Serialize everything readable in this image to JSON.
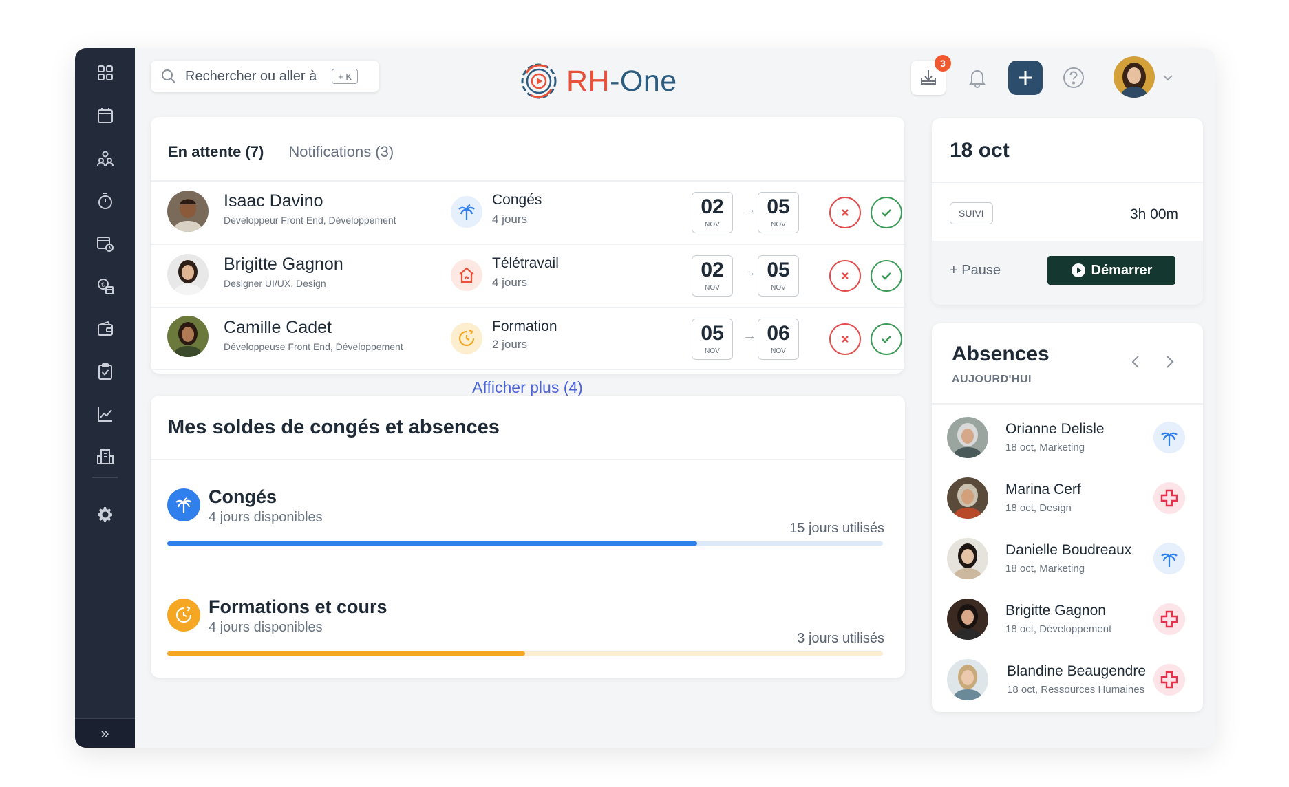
{
  "app": {
    "logo_rh": "RH",
    "logo_one": "-One"
  },
  "sidebar": {
    "items": [
      "dashboard",
      "calendar",
      "team",
      "timer",
      "schedule",
      "finance",
      "wallet",
      "tasks",
      "analytics",
      "organization",
      "settings"
    ],
    "collapse_label": "»"
  },
  "search": {
    "label": "Rechercher ou aller à",
    "shortcut": "+ K"
  },
  "topbar": {
    "inbox_count": "3"
  },
  "requests": {
    "tabs": [
      "En attente (7)",
      "Notifications (3)"
    ],
    "rows": [
      {
        "name": "Isaac Davino",
        "role": "Développeur Front End, Développement",
        "type": "Congés",
        "days": "4 jours",
        "from_day": "02",
        "from_month": "NOV",
        "to_day": "05",
        "to_month": "NOV"
      },
      {
        "name": "Brigitte Gagnon",
        "role": "Designer UI/UX, Design",
        "type": "Télétravail",
        "days": "4 jours",
        "from_day": "02",
        "from_month": "NOV",
        "to_day": "05",
        "to_month": "NOV"
      },
      {
        "name": "Camille Cadet",
        "role": "Développeuse Front End, Développement",
        "type": "Formation",
        "days": "2 jours",
        "from_day": "05",
        "from_month": "NOV",
        "to_day": "06",
        "to_month": "NOV"
      }
    ],
    "show_more": "Afficher plus (4)"
  },
  "balances": {
    "title": "Mes soldes de congés et absences",
    "items": [
      {
        "name": "Congés",
        "available": "4 jours disponibles",
        "used": "15 jours utilisés",
        "progress": 0.74,
        "color": "#2f80ed",
        "track": "#dce9fb"
      },
      {
        "name": "Formations et cours",
        "available": "4 jours disponibles",
        "used": "3 jours utilisés",
        "progress": 0.5,
        "color": "#f5a623",
        "track": "#fbecd2"
      }
    ]
  },
  "tracker": {
    "date": "18 oct",
    "badge": "SUIVI",
    "duration": "3h 00m",
    "pause": "+ Pause",
    "start": "Démarrer"
  },
  "absences": {
    "title": "Absences",
    "subtitle": "AUJOURD'HUI",
    "rows": [
      {
        "name": "Orianne Delisle",
        "detail": "18 oct, Marketing",
        "icon": "palm-icon"
      },
      {
        "name": "Marina Cerf",
        "detail": "18 oct, Design",
        "icon": "medical-cross-icon"
      },
      {
        "name": "Danielle Boudreaux",
        "detail": "18 oct, Marketing",
        "icon": "palm-icon"
      },
      {
        "name": "Brigitte Gagnon",
        "detail": "18 oct, Développement",
        "icon": "medical-cross-icon"
      },
      {
        "name": "Blandine Beaugendre",
        "detail": "18 oct, Ressources Humaines",
        "icon": "medical-cross-icon"
      }
    ]
  }
}
